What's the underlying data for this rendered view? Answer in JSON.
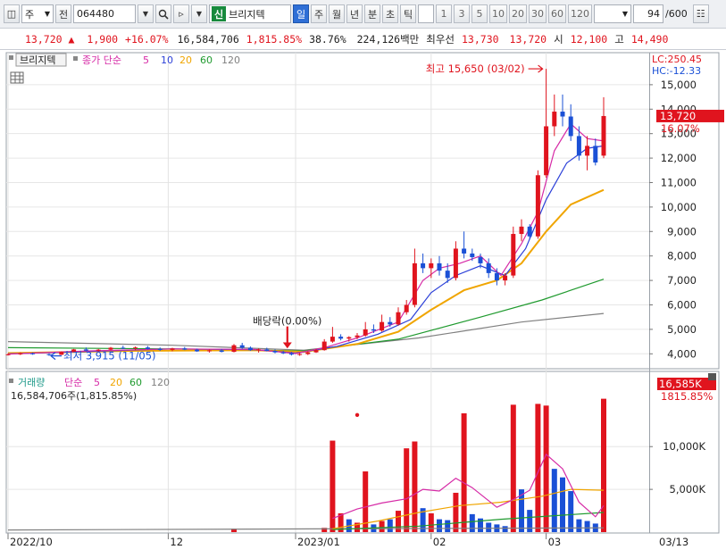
{
  "toolbar": {
    "period_select": "주",
    "ref_label": "전",
    "code_value": "064480",
    "sin_badge": "신",
    "stock_name": "브리지텍",
    "period_buttons": [
      "일",
      "주",
      "월",
      "년",
      "분",
      "초",
      "틱"
    ],
    "interval_buttons": [
      "1",
      "3",
      "5",
      "10",
      "20",
      "30",
      "60",
      "120"
    ],
    "count_value": "94",
    "count_total": "/600"
  },
  "quote": {
    "price": "13,720",
    "arrow": "▲",
    "change": "1,900",
    "change_pct": "+16.07%",
    "volume": "16,584,706",
    "vol_ratio": "1,815.85%",
    "turnover": "38.76%",
    "trade_value": "224,126백만",
    "best_bid_label": "최우선",
    "best_ask": "13,730",
    "best_bid": "13,720",
    "open_label": "시",
    "open": "12,100",
    "high_label": "고",
    "high": "14,490"
  },
  "colors": {
    "up": "#e0141e",
    "down": "#1a50d6",
    "ma5": "#d62aa6",
    "ma10": "#2b3fd8",
    "ma20": "#f0a500",
    "ma60": "#1f9a2e",
    "ma120": "#808080"
  },
  "chart_data": {
    "type": "candlestick",
    "price_legend": {
      "name": "브리지텍",
      "ma_label": "종가 단순",
      "ma_periods": [
        "5",
        "10",
        "20",
        "60",
        "120"
      ]
    },
    "volume_legend": {
      "name": "거래량",
      "ma_label": "단순",
      "ma_periods": [
        "5",
        "20",
        "60",
        "120"
      ],
      "value_text": "16,584,706주(1,815.85%)"
    },
    "price_axis_ticks": [
      4000,
      5000,
      6000,
      7000,
      8000,
      9000,
      10000,
      11000,
      12000,
      13000,
      14000,
      15000
    ],
    "price_axis_labels": [
      "4,000",
      "5,000",
      "6,000",
      "7,000",
      "8,000",
      "9,000",
      "10,000",
      "11,000",
      "12,000",
      "13,000",
      "14,000",
      "15,000"
    ],
    "ylim": [
      3500,
      16200
    ],
    "volume_axis_labels": [
      "5,000K",
      "10,000K"
    ],
    "volume_axis_ticks": [
      5000000,
      10000000
    ],
    "volume_ylim": [
      0,
      16500000
    ],
    "lc": "LC:250.45",
    "hc": "HC:-12.33",
    "current_price_box": "13,720",
    "current_pct": "16.07%",
    "current_volume_box": "16,585K",
    "current_volume_pct": "1815.85%",
    "x_labels": [
      {
        "text": "2022/10",
        "index": 0
      },
      {
        "text": "12",
        "index": 39
      },
      {
        "text": "2023/01",
        "index": 70
      },
      {
        "text": "02",
        "index": 103
      },
      {
        "text": "03",
        "index": 131
      },
      {
        "text": "03/13",
        "index": 153
      }
    ],
    "annotations": {
      "high_text": "최고 15,650 (03/02)",
      "high_value": 15650,
      "high_index": 131,
      "low_text": "최저 3,915 (11/05)",
      "low_value": 3915,
      "low_index": 10,
      "dividend_text": "배당락(0.00%)",
      "dividend_index": 68
    },
    "candles": [
      {
        "i": 0,
        "o": 3960,
        "h": 4020,
        "l": 3930,
        "c": 3980
      },
      {
        "i": 3,
        "o": 3980,
        "h": 4060,
        "l": 3950,
        "c": 4020
      },
      {
        "i": 6,
        "o": 4020,
        "h": 4050,
        "l": 3960,
        "c": 3985
      },
      {
        "i": 10,
        "o": 3985,
        "h": 4020,
        "l": 3915,
        "c": 3960
      },
      {
        "i": 13,
        "o": 3960,
        "h": 4100,
        "l": 3950,
        "c": 4080
      },
      {
        "i": 16,
        "o": 4080,
        "h": 4200,
        "l": 4060,
        "c": 4180
      },
      {
        "i": 19,
        "o": 4180,
        "h": 4260,
        "l": 4100,
        "c": 4130
      },
      {
        "i": 22,
        "o": 4130,
        "h": 4200,
        "l": 4080,
        "c": 4170
      },
      {
        "i": 25,
        "o": 4170,
        "h": 4280,
        "l": 4140,
        "c": 4250
      },
      {
        "i": 28,
        "o": 4250,
        "h": 4330,
        "l": 4200,
        "c": 4230
      },
      {
        "i": 31,
        "o": 4230,
        "h": 4300,
        "l": 4150,
        "c": 4260
      },
      {
        "i": 34,
        "o": 4260,
        "h": 4320,
        "l": 4180,
        "c": 4200
      },
      {
        "i": 37,
        "o": 4200,
        "h": 4260,
        "l": 4120,
        "c": 4160
      },
      {
        "i": 40,
        "o": 4160,
        "h": 4250,
        "l": 4100,
        "c": 4220
      },
      {
        "i": 43,
        "o": 4220,
        "h": 4280,
        "l": 4150,
        "c": 4170
      },
      {
        "i": 46,
        "o": 4170,
        "h": 4210,
        "l": 4080,
        "c": 4100
      },
      {
        "i": 49,
        "o": 4100,
        "h": 4180,
        "l": 4050,
        "c": 4140
      },
      {
        "i": 52,
        "o": 4140,
        "h": 4200,
        "l": 4060,
        "c": 4080
      },
      {
        "i": 55,
        "o": 4080,
        "h": 4400,
        "l": 4060,
        "c": 4350
      },
      {
        "i": 57,
        "o": 4350,
        "h": 4450,
        "l": 4200,
        "c": 4250
      },
      {
        "i": 59,
        "o": 4250,
        "h": 4300,
        "l": 4120,
        "c": 4150
      },
      {
        "i": 61,
        "o": 4150,
        "h": 4220,
        "l": 4050,
        "c": 4180
      },
      {
        "i": 63,
        "o": 4180,
        "h": 4250,
        "l": 4100,
        "c": 4120
      },
      {
        "i": 65,
        "o": 4120,
        "h": 4180,
        "l": 4020,
        "c": 4060
      },
      {
        "i": 67,
        "o": 4060,
        "h": 4120,
        "l": 3990,
        "c": 4020
      },
      {
        "i": 69,
        "o": 4020,
        "h": 4080,
        "l": 3930,
        "c": 3970
      },
      {
        "i": 71,
        "o": 3970,
        "h": 4040,
        "l": 3920,
        "c": 3990
      },
      {
        "i": 73,
        "o": 3990,
        "h": 4100,
        "l": 3950,
        "c": 4060
      },
      {
        "i": 75,
        "o": 4060,
        "h": 4200,
        "l": 4040,
        "c": 4150
      },
      {
        "i": 77,
        "o": 4150,
        "h": 4600,
        "l": 4130,
        "c": 4500
      },
      {
        "i": 79,
        "o": 4500,
        "h": 5100,
        "l": 4450,
        "c": 4700
      },
      {
        "i": 81,
        "o": 4700,
        "h": 4800,
        "l": 4550,
        "c": 4620
      },
      {
        "i": 83,
        "o": 4620,
        "h": 4720,
        "l": 4500,
        "c": 4680
      },
      {
        "i": 85,
        "o": 4680,
        "h": 4850,
        "l": 4600,
        "c": 4750
      },
      {
        "i": 87,
        "o": 4750,
        "h": 5300,
        "l": 4700,
        "c": 5000
      },
      {
        "i": 89,
        "o": 5000,
        "h": 5200,
        "l": 4850,
        "c": 4950
      },
      {
        "i": 91,
        "o": 4950,
        "h": 5600,
        "l": 4900,
        "c": 5300
      },
      {
        "i": 93,
        "o": 5300,
        "h": 5500,
        "l": 5100,
        "c": 5200
      },
      {
        "i": 95,
        "o": 5200,
        "h": 5900,
        "l": 5150,
        "c": 5700
      },
      {
        "i": 97,
        "o": 5700,
        "h": 6200,
        "l": 5600,
        "c": 6000
      },
      {
        "i": 99,
        "o": 6000,
        "h": 8300,
        "l": 5900,
        "c": 7700
      },
      {
        "i": 101,
        "o": 7700,
        "h": 8100,
        "l": 7300,
        "c": 7500
      },
      {
        "i": 103,
        "o": 7500,
        "h": 7900,
        "l": 7100,
        "c": 7700
      },
      {
        "i": 105,
        "o": 7700,
        "h": 8000,
        "l": 7200,
        "c": 7400
      },
      {
        "i": 107,
        "o": 7400,
        "h": 7700,
        "l": 6900,
        "c": 7100
      },
      {
        "i": 109,
        "o": 7100,
        "h": 8600,
        "l": 7000,
        "c": 8300
      },
      {
        "i": 111,
        "o": 8300,
        "h": 9000,
        "l": 7900,
        "c": 8100
      },
      {
        "i": 113,
        "o": 8100,
        "h": 8300,
        "l": 7800,
        "c": 7950
      },
      {
        "i": 115,
        "o": 7950,
        "h": 8100,
        "l": 7500,
        "c": 7700
      },
      {
        "i": 117,
        "o": 7700,
        "h": 7900,
        "l": 7100,
        "c": 7300
      },
      {
        "i": 119,
        "o": 7300,
        "h": 7500,
        "l": 6800,
        "c": 7000
      },
      {
        "i": 121,
        "o": 7000,
        "h": 7300,
        "l": 6800,
        "c": 7200
      },
      {
        "i": 123,
        "o": 7200,
        "h": 9200,
        "l": 7100,
        "c": 8900
      },
      {
        "i": 125,
        "o": 8900,
        "h": 9500,
        "l": 8600,
        "c": 9200
      },
      {
        "i": 127,
        "o": 9200,
        "h": 9300,
        "l": 8700,
        "c": 8800
      },
      {
        "i": 129,
        "o": 8800,
        "h": 11500,
        "l": 8700,
        "c": 11300
      },
      {
        "i": 131,
        "o": 11300,
        "h": 15650,
        "l": 11200,
        "c": 13300
      },
      {
        "i": 133,
        "o": 13300,
        "h": 14600,
        "l": 12900,
        "c": 13900
      },
      {
        "i": 135,
        "o": 13900,
        "h": 14600,
        "l": 13300,
        "c": 13700
      },
      {
        "i": 137,
        "o": 13700,
        "h": 14200,
        "l": 12700,
        "c": 12900
      },
      {
        "i": 139,
        "o": 12900,
        "h": 13300,
        "l": 11900,
        "c": 12100
      },
      {
        "i": 141,
        "o": 12100,
        "h": 12900,
        "l": 11500,
        "c": 12500
      },
      {
        "i": 143,
        "o": 12500,
        "h": 12800,
        "l": 11700,
        "c": 11820
      },
      {
        "i": 145,
        "o": 12100,
        "h": 14490,
        "l": 12000,
        "c": 13720
      }
    ],
    "ma5": [
      [
        0,
        3990
      ],
      [
        20,
        4120
      ],
      [
        40,
        4200
      ],
      [
        60,
        4180
      ],
      [
        70,
        4010
      ],
      [
        77,
        4250
      ],
      [
        85,
        4650
      ],
      [
        95,
        5300
      ],
      [
        101,
        7000
      ],
      [
        105,
        7500
      ],
      [
        110,
        7700
      ],
      [
        115,
        8000
      ],
      [
        120,
        7200
      ],
      [
        125,
        8500
      ],
      [
        129,
        9800
      ],
      [
        133,
        12300
      ],
      [
        137,
        13400
      ],
      [
        141,
        12800
      ],
      [
        145,
        12700
      ]
    ],
    "ma10": [
      [
        0,
        4000
      ],
      [
        20,
        4100
      ],
      [
        40,
        4200
      ],
      [
        60,
        4170
      ],
      [
        70,
        4030
      ],
      [
        80,
        4300
      ],
      [
        90,
        4800
      ],
      [
        98,
        5400
      ],
      [
        103,
        6500
      ],
      [
        109,
        7200
      ],
      [
        115,
        7600
      ],
      [
        121,
        7200
      ],
      [
        126,
        8300
      ],
      [
        131,
        10300
      ],
      [
        136,
        11800
      ],
      [
        141,
        12400
      ],
      [
        145,
        12500
      ]
    ],
    "ma20": [
      [
        0,
        4030
      ],
      [
        30,
        4120
      ],
      [
        60,
        4150
      ],
      [
        72,
        4080
      ],
      [
        85,
        4400
      ],
      [
        95,
        4900
      ],
      [
        103,
        5800
      ],
      [
        111,
        6600
      ],
      [
        119,
        7000
      ],
      [
        125,
        7700
      ],
      [
        131,
        9000
      ],
      [
        137,
        10100
      ],
      [
        145,
        10700
      ]
    ],
    "ma60": [
      [
        0,
        4250
      ],
      [
        40,
        4200
      ],
      [
        72,
        4120
      ],
      [
        95,
        4600
      ],
      [
        115,
        5500
      ],
      [
        130,
        6200
      ],
      [
        145,
        7050
      ]
    ],
    "ma120": [
      [
        0,
        4500
      ],
      [
        40,
        4350
      ],
      [
        72,
        4150
      ],
      [
        100,
        4650
      ],
      [
        125,
        5300
      ],
      [
        145,
        5650
      ]
    ],
    "volumes": [
      {
        "i": 55,
        "v": 400000,
        "up": true
      },
      {
        "i": 77,
        "v": 500000,
        "up": true
      },
      {
        "i": 79,
        "v": 10700000,
        "up": true
      },
      {
        "i": 81,
        "v": 2200000,
        "up": true
      },
      {
        "i": 83,
        "v": 1500000,
        "up": false
      },
      {
        "i": 85,
        "v": 1100000,
        "up": true
      },
      {
        "i": 87,
        "v": 7100000,
        "up": true
      },
      {
        "i": 89,
        "v": 900000,
        "up": false
      },
      {
        "i": 91,
        "v": 1300000,
        "up": true
      },
      {
        "i": 93,
        "v": 1500000,
        "up": false
      },
      {
        "i": 95,
        "v": 2500000,
        "up": true
      },
      {
        "i": 97,
        "v": 9800000,
        "up": true
      },
      {
        "i": 99,
        "v": 10600000,
        "up": true
      },
      {
        "i": 101,
        "v": 2800000,
        "up": false
      },
      {
        "i": 103,
        "v": 2200000,
        "up": true
      },
      {
        "i": 105,
        "v": 1500000,
        "up": false
      },
      {
        "i": 107,
        "v": 1400000,
        "up": false
      },
      {
        "i": 109,
        "v": 4600000,
        "up": true
      },
      {
        "i": 111,
        "v": 13900000,
        "up": true
      },
      {
        "i": 113,
        "v": 2100000,
        "up": false
      },
      {
        "i": 115,
        "v": 1600000,
        "up": false
      },
      {
        "i": 117,
        "v": 1100000,
        "up": false
      },
      {
        "i": 119,
        "v": 900000,
        "up": false
      },
      {
        "i": 121,
        "v": 700000,
        "up": false
      },
      {
        "i": 123,
        "v": 14900000,
        "up": true
      },
      {
        "i": 125,
        "v": 5000000,
        "up": false
      },
      {
        "i": 127,
        "v": 2600000,
        "up": false
      },
      {
        "i": 129,
        "v": 15000000,
        "up": true
      },
      {
        "i": 131,
        "v": 14800000,
        "up": true
      },
      {
        "i": 133,
        "v": 7400000,
        "up": false
      },
      {
        "i": 135,
        "v": 6400000,
        "up": false
      },
      {
        "i": 137,
        "v": 4800000,
        "up": false
      },
      {
        "i": 139,
        "v": 1500000,
        "up": false
      },
      {
        "i": 141,
        "v": 1300000,
        "up": false
      },
      {
        "i": 143,
        "v": 1000000,
        "up": false
      },
      {
        "i": 145,
        "v": 15600000,
        "up": true
      }
    ],
    "vol_ma5": [
      [
        79,
        1600000
      ],
      [
        85,
        2700000
      ],
      [
        91,
        3400000
      ],
      [
        97,
        3900000
      ],
      [
        101,
        5000000
      ],
      [
        105,
        4800000
      ],
      [
        109,
        6300000
      ],
      [
        113,
        5200000
      ],
      [
        119,
        2900000
      ],
      [
        123,
        3800000
      ],
      [
        127,
        4900000
      ],
      [
        131,
        9100000
      ],
      [
        135,
        7400000
      ],
      [
        139,
        3500000
      ],
      [
        143,
        1800000
      ],
      [
        145,
        3100000
      ]
    ],
    "vol_ma20": [
      [
        79,
        400000
      ],
      [
        90,
        1300000
      ],
      [
        100,
        2300000
      ],
      [
        110,
        3100000
      ],
      [
        120,
        3500000
      ],
      [
        130,
        4200000
      ],
      [
        137,
        5000000
      ],
      [
        145,
        4900000
      ]
    ],
    "vol_ma60": [
      [
        79,
        300000
      ],
      [
        100,
        700000
      ],
      [
        120,
        1500000
      ],
      [
        145,
        2300000
      ]
    ],
    "vol_ma120": [
      [
        0,
        250000
      ],
      [
        145,
        500000
      ]
    ],
    "vol_marker": {
      "i": 85,
      "v": 13700000
    }
  }
}
